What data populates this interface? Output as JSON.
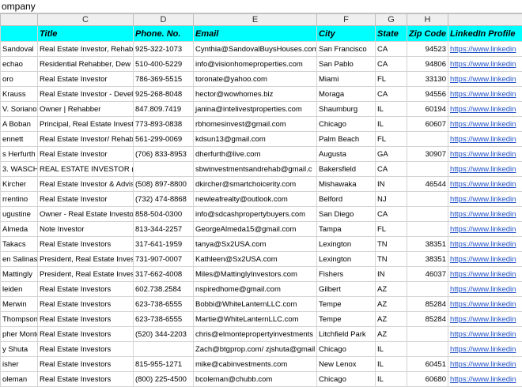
{
  "formula_bar": {
    "text": "ompany"
  },
  "column_letters": [
    "",
    "C",
    "D",
    "E",
    "F",
    "G",
    "H",
    ""
  ],
  "headers": [
    "",
    "Title",
    "Phone. No.",
    "Email",
    "City",
    "State",
    "Zip Code",
    "LinkedIn Profile"
  ],
  "rows": [
    [
      "Sandoval",
      "Real Estate Investor, Rehab",
      "925-322-1073",
      "Cynthia@SandovalBuysHouses.com",
      "San Francisco",
      "CA",
      "94523",
      "https://www.linkedin"
    ],
    [
      "echao",
      "Residential Rehabber, Dew",
      "510-400-5229",
      "info@visionhomeproperties.com",
      "San Pablo",
      "CA",
      "94806",
      "https://www.linkedin"
    ],
    [
      "oro",
      "Real Estate Investor",
      "786-369-5515",
      "toronate@yahoo.com",
      "Miami",
      "FL",
      "33130",
      "https://www.linkedin"
    ],
    [
      "Krauss",
      "Real Estate Investor - Devel",
      "925-268-8048",
      "hector@wowhomes.biz",
      "Moraga",
      "CA",
      "94556",
      "https://www.linkedin"
    ],
    [
      "V. Soriano",
      "Owner | Rehabber",
      "847.809.7419",
      "janina@intelivestproperties.com",
      "Shaumburg",
      "IL",
      "60194",
      "https://www.linkedin"
    ],
    [
      "A Boban",
      "Principal, Real Estate Invest",
      "773-893-0838",
      "rbhomesinvest@gmail.com",
      "Chicago",
      "IL",
      "60607",
      "https://www.linkedin"
    ],
    [
      "ennett",
      "Real Estate Investor/ Rehab",
      "561-299-0069",
      "kdsun13@gmail.com",
      "Palm Beach",
      "FL",
      "",
      "https://www.linkedin"
    ],
    [
      "s Herfurth",
      "Real Estate Investor",
      "(706) 833-8953",
      "dherfurth@live.com",
      "Augusta",
      "GA",
      "30907",
      "https://www.linkedin"
    ],
    [
      "3. WASCHER",
      "REAL ESTATE INVESTOR (REH.",
      "",
      "sbwinvestmentsandrehab@gmail.c",
      "Bakersfield",
      "CA",
      "",
      "https://www.linkedin"
    ],
    [
      "Kircher",
      "Real Estate Investor & Advis",
      "(508) 897-8800",
      "dkircher@smartchoicerity.com",
      "Mishawaka",
      "IN",
      "46544",
      "https://www.linkedin"
    ],
    [
      "rrentino",
      "Real Estate Investor",
      "(732) 474-8868",
      "newleafrealty@outlook.com",
      "Belford",
      "NJ",
      "",
      "https://www.linkedin"
    ],
    [
      "ugustine",
      "Owner - Real Estate Investo",
      "858-504-0300",
      "info@sdcashpropertybuyers.com",
      "San Diego",
      "CA",
      "",
      "https://www.linkedin"
    ],
    [
      "Almeda",
      "Note Investor",
      "813-344-2257",
      "GeorgeAlmeda15@gmail.com",
      "Tampa",
      "FL",
      "",
      "https://www.linkedin"
    ],
    [
      "Takacs",
      "Real Estate Investors",
      "317-641-1959",
      "tanya@Sx2USA.com",
      "Lexington",
      "TN",
      "38351",
      "https://www.linkedin"
    ],
    [
      "en Salinas",
      "President, Real Estate Inves",
      "731-907-0007",
      "Kathleen@Sx2USA.com",
      "Lexington",
      "TN",
      "38351",
      "https://www.linkedin"
    ],
    [
      "Mattingly",
      "President, Real Estate Inves",
      "317-662-4008",
      "Miles@MattinglyInvestors.com",
      "Fishers",
      "IN",
      "46037",
      "https://www.linkedin"
    ],
    [
      "leiden",
      "Real Estate Investors",
      "602.738.2584",
      "nspiredhome@gmail.com",
      "Gilbert",
      "AZ",
      "",
      "https://www.linkedin"
    ],
    [
      "Merwin",
      "Real Estate Investors",
      "623-738-6555",
      "Bobbi@WhiteLanternLLC.com",
      "Tempe",
      "AZ",
      "85284",
      "https://www.linkedin"
    ],
    [
      "Thompson",
      "Real Estate Investors",
      "623-738-6555",
      "Martie@WhiteLanternLLC.com",
      "Tempe",
      "AZ",
      "85284",
      "https://www.linkedin"
    ],
    [
      "pher Monte",
      "Real Estate Investors",
      "(520) 344-2203",
      "chris@elmontepropertyinvestments",
      "Litchfield Park",
      "AZ",
      "",
      "https://www.linkedin"
    ],
    [
      "y Shuta",
      "Real Estate Investors",
      "",
      "Zach@btgprop.com/ zjshuta@gmail",
      "Chicago",
      "IL",
      "",
      "https://www.linkedin"
    ],
    [
      "isher",
      "Real Estate Investors",
      "815-955-1271",
      "mike@cabinvestments.com",
      "New Lenox",
      "IL",
      "60451",
      "https://www.linkedin"
    ],
    [
      "oleman",
      "Real Estate Investors",
      "(800) 225-4500",
      "bcoleman@chubb.com",
      "Chicago",
      "IL",
      "60680",
      "https://www.linkedin"
    ]
  ]
}
